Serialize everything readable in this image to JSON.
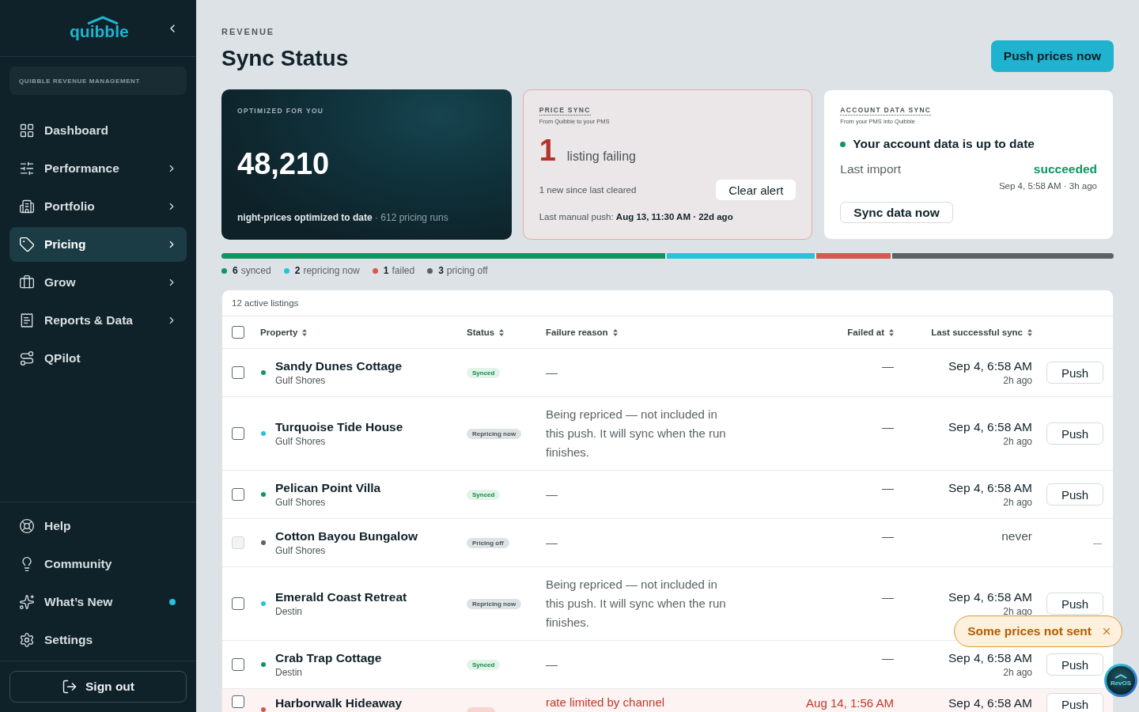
{
  "sidebar": {
    "logo_text": "quibble",
    "org_label": "QUIBBLE REVENUE MANAGEMENT",
    "nav_items": [
      {
        "label": "Dashboard",
        "expandable": false,
        "selected": false
      },
      {
        "label": "Performance",
        "expandable": true,
        "selected": false
      },
      {
        "label": "Portfolio",
        "expandable": true,
        "selected": false
      },
      {
        "label": "Pricing",
        "expandable": true,
        "selected": true
      },
      {
        "label": "Grow",
        "expandable": true,
        "selected": false
      },
      {
        "label": "Reports & Data",
        "expandable": true,
        "selected": false
      },
      {
        "label": "QPilot",
        "expandable": false,
        "selected": false
      }
    ],
    "footer_items": [
      {
        "label": "Help",
        "has_update": false,
        "selected": false
      },
      {
        "label": "Community",
        "has_update": false,
        "selected": false
      },
      {
        "label": "What’s New",
        "has_update": true,
        "selected": false
      },
      {
        "label": "Settings",
        "has_update": false,
        "selected": false
      }
    ],
    "sign_out": "Sign out"
  },
  "header": {
    "eyebrow": "REVENUE",
    "title": "Sync Status",
    "push_button": "Push prices now"
  },
  "optimized_card": {
    "label": "OPTIMIZED FOR YOU",
    "value": "48,210",
    "caption": "**night-prices optimized to date** · 612 pricing runs"
  },
  "price_sync_card": {
    "label": "PRICE SYNC",
    "sublabel": "From Quibble to your PMS",
    "alert": true,
    "failing_count": "1",
    "failing_text": "listing failing",
    "new_text": "1 new since last cleared",
    "clear_button": "Clear alert",
    "last_push": "Last manual push: **Aug 13, 11:30 AM · 22d ago**"
  },
  "account_sync_card": {
    "label": "ACCOUNT DATA SYNC",
    "sublabel": "From your PMS into Quibble",
    "up_to_date": true,
    "status_text": "Your account data is up to date",
    "import_label": "Last import",
    "import_result": "succeeded",
    "import_ok": true,
    "import_time": "Sep 4, 5:58 AM · 3h ago",
    "sync_button": "Sync data now"
  },
  "status_bar": {
    "segments": [
      {
        "count": "6",
        "label": "synced",
        "color": "#0e9660"
      },
      {
        "count": "2",
        "label": "repricing now",
        "color": "#27c3d8"
      },
      {
        "count": "1",
        "label": "failed",
        "color": "#d9574c"
      },
      {
        "count": "3",
        "label": "pricing off",
        "color": "#5b6266"
      }
    ]
  },
  "table": {
    "caption": "12 active listings",
    "select_all": {
      "checked": false
    },
    "columns": [
      "Property",
      "Status",
      "Failure reason",
      "Failed at",
      "Last successful sync"
    ],
    "rows": [
      {
        "name": "Sandy Dunes Cottage",
        "location": "Gulf Shores",
        "checked": false,
        "disabled": false,
        "status": {
          "kind": "synced",
          "label": "Synced"
        },
        "failure_reason": "—",
        "failed_at": "—",
        "last_sync": "Sep 4, 6:58 AM",
        "last_sync_ago": "2h ago",
        "action": {
          "kind": "button",
          "label": "Push"
        }
      },
      {
        "name": "Turquoise Tide House",
        "location": "Gulf Shores",
        "checked": false,
        "disabled": false,
        "status": {
          "kind": "repricing",
          "label": "Repricing now"
        },
        "failure_reason": "Being repriced — not included in this push. It will sync when the run finishes.",
        "failed_at": "—",
        "last_sync": "Sep 4, 6:58 AM",
        "last_sync_ago": "2h ago",
        "action": {
          "kind": "button",
          "label": "Push"
        }
      },
      {
        "name": "Pelican Point Villa",
        "location": "Gulf Shores",
        "checked": false,
        "disabled": false,
        "status": {
          "kind": "synced",
          "label": "Synced"
        },
        "failure_reason": "—",
        "failed_at": "—",
        "last_sync": "Sep 4, 6:58 AM",
        "last_sync_ago": "2h ago",
        "action": {
          "kind": "button",
          "label": "Push"
        }
      },
      {
        "name": "Cotton Bayou Bungalow",
        "location": "Gulf Shores",
        "checked": false,
        "disabled": true,
        "status": {
          "kind": "pricing_off",
          "label": "Pricing off"
        },
        "failure_reason": "—",
        "failed_at": "—",
        "last_sync": "never",
        "action": {
          "kind": "text",
          "label": "—"
        }
      },
      {
        "name": "Emerald Coast Retreat",
        "location": "Destin",
        "checked": false,
        "disabled": false,
        "status": {
          "kind": "repricing",
          "label": "Repricing now"
        },
        "failure_reason": "Being repriced — not included in this push. It will sync when the run finishes.",
        "failed_at": "—",
        "last_sync": "Sep 4, 6:58 AM",
        "last_sync_ago": "2h ago",
        "action": {
          "kind": "button",
          "label": "Push"
        }
      },
      {
        "name": "Crab Trap Cottage",
        "location": "Destin",
        "checked": false,
        "disabled": false,
        "status": {
          "kind": "synced",
          "label": "Synced"
        },
        "failure_reason": "—",
        "failed_at": "—",
        "last_sync": "Sep 4, 6:58 AM",
        "last_sync_ago": "2h ago",
        "action": {
          "kind": "button",
          "label": "Push"
        }
      },
      {
        "name": "Harborwalk Hideaway",
        "checked": false,
        "disabled": false,
        "status": {
          "kind": "failed"
        },
        "failure_reason": "rate limited by channel",
        "failed_at": "Aug 14, 1:56 AM",
        "last_sync": "Sep 4, 6:58 AM",
        "action": {
          "kind": "button",
          "label": "Push"
        }
      }
    ]
  },
  "toast": {
    "message": "Some prices not sent"
  },
  "assistant_button": {
    "label": "RevOS"
  }
}
